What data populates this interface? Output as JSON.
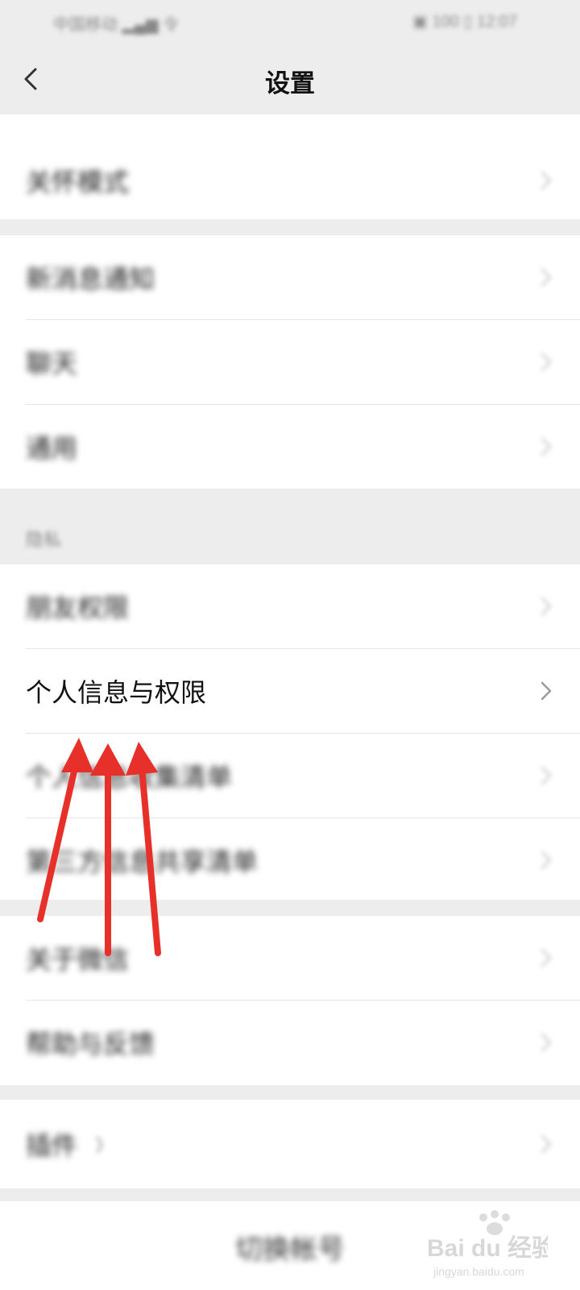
{
  "status_bar": {
    "left": "中国移动 ▂▄▆ 令",
    "right": "▣ 100 ▯ 12:07"
  },
  "header": {
    "title": "设置"
  },
  "groups": [
    {
      "items": [
        "关怀模式"
      ]
    },
    {
      "items": [
        "新消息通知",
        "聊天",
        "通用"
      ]
    },
    {
      "section_label": "隐私",
      "items": [
        "朋友权限",
        "个人信息与权限",
        "个人信息收集清单",
        "第三方信息共享清单"
      ]
    },
    {
      "items": [
        "关于微信",
        "帮助与反馈"
      ]
    },
    {
      "items": [
        "插件"
      ]
    }
  ],
  "plugin_badge": "》",
  "switch_account": "切换帐号",
  "watermark": {
    "brand": "Bai du 经验",
    "url": "jingyan.baidu.com"
  },
  "colors": {
    "background": "#ededed",
    "card": "#ffffff",
    "arrow": "#e8302a"
  },
  "icons": {
    "back": "chevron-left-icon",
    "row_arrow": "chevron-right-icon"
  }
}
